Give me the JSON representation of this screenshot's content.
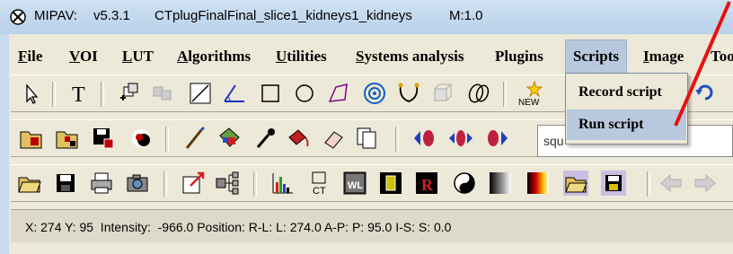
{
  "window": {
    "app_name": "MIPAV:",
    "version": "v5.3.1",
    "filename": "CTplugFinalFinal_slice1_kidneys1_kidneys",
    "mode": "M:1.0"
  },
  "menubar": [
    {
      "label": "File",
      "ul": "F",
      "rest": "ile"
    },
    {
      "label": "VOI",
      "ul": "V",
      "rest": "OI"
    },
    {
      "label": "LUT",
      "ul": "L",
      "rest": "UT"
    },
    {
      "label": "Algorithms",
      "ul": "A",
      "rest": "lgorithms"
    },
    {
      "label": "Utilities",
      "ul": "U",
      "rest": "tilities"
    },
    {
      "label": "Systems analysis",
      "ul": "S",
      "rest": "ystems analysis"
    },
    {
      "label": "Plugins",
      "ul": "",
      "rest": "Plugins"
    },
    {
      "label": "Scripts",
      "ul": "",
      "rest": "Scripts"
    },
    {
      "label": "Image",
      "ul": "I",
      "rest": "mage"
    },
    {
      "label": "Too",
      "ul": "",
      "rest": "Too"
    }
  ],
  "scripts_menu": {
    "record": "Record script",
    "run": "Run script"
  },
  "toolbar2": {
    "search_value": "squ"
  },
  "status": {
    "text": "X: 274 Y: 95  Intensity:  -966.0 Position: R-L: L: 274.0 A-P: P: 95.0 I-S: S: 0.0"
  },
  "colors": {
    "annotation_arrow": "#e81010",
    "menu_highlight": "#b8c8de"
  }
}
